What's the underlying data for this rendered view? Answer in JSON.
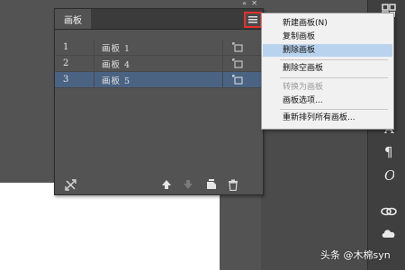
{
  "panel": {
    "tab_label": "画板",
    "rows": [
      {
        "num": "1",
        "name": "画板 1",
        "selected": false
      },
      {
        "num": "2",
        "name": "画板 4",
        "selected": false
      },
      {
        "num": "3",
        "name": "画板 5",
        "selected": true
      }
    ]
  },
  "menu": {
    "items": [
      {
        "label": "新建画板(N)",
        "highlighted": false,
        "disabled": false
      },
      {
        "label": "复制画板",
        "highlighted": false,
        "disabled": false
      },
      {
        "label": "删除画板",
        "highlighted": true,
        "disabled": false
      },
      {
        "label": "删除空画板",
        "highlighted": false,
        "disabled": false
      },
      {
        "label": "转换为画板",
        "highlighted": false,
        "disabled": true
      },
      {
        "label": "画板选项...",
        "highlighted": false,
        "disabled": false
      },
      {
        "label": "重新排列所有画板...",
        "highlighted": false,
        "disabled": false
      }
    ]
  },
  "watermark": "头条 @木棉syn",
  "colors": {
    "selected_row": "#4a6382",
    "menu_highlight": "#b9d3ee",
    "menu_button_outline": "#e8302c"
  }
}
